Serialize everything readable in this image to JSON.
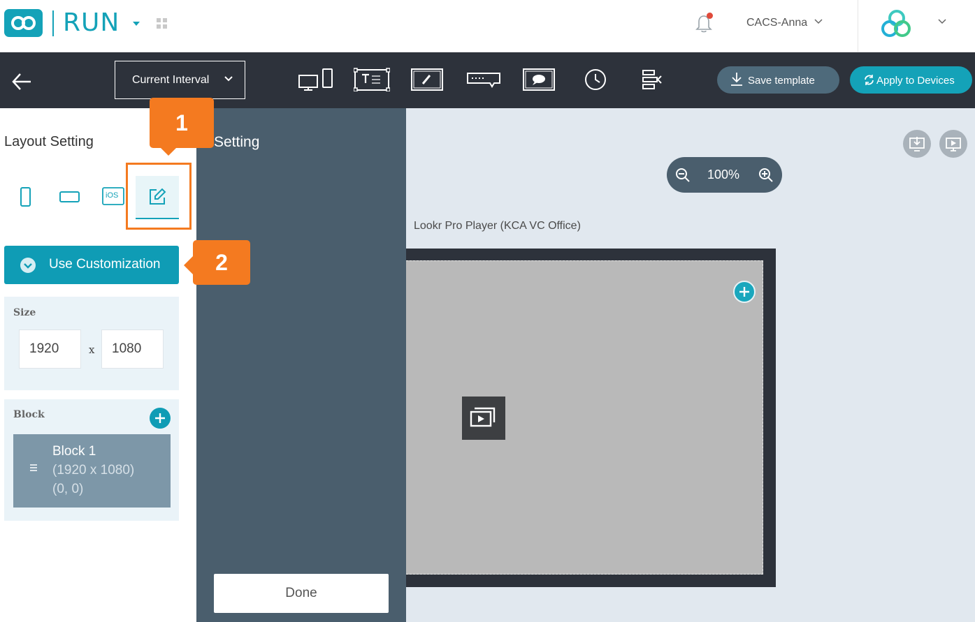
{
  "header": {
    "app_name": "RUN",
    "user_name": "CACS-Anna"
  },
  "toolbar": {
    "interval_select": "Current Interval",
    "tools": [
      "device-toggle-icon",
      "text-widget-icon",
      "draw-icon",
      "ticker-icon",
      "message-icon",
      "clock-icon",
      "align-icon"
    ],
    "save_label": "Save template",
    "apply_label": "Apply to Devices"
  },
  "left_panel": {
    "title": "Layout Setting",
    "orientations": [
      "portrait",
      "landscape",
      "iOS",
      "custom"
    ],
    "ios_label": "iOS",
    "use_customization_label": "Use Customization",
    "size": {
      "label": "Size",
      "width": "1920",
      "height": "1080",
      "separator": "x"
    },
    "block_section": {
      "label": "Block",
      "items": [
        {
          "name": "Block 1",
          "size": "(1920 x 1080)",
          "position": "(0, 0)"
        }
      ]
    }
  },
  "settings_panel": {
    "title": "Setting",
    "done_label": "Done"
  },
  "canvas": {
    "zoom": "100%",
    "device_name": "Lookr Pro Player (KCA VC Office)"
  },
  "callouts": {
    "step1": "1",
    "step2": "2"
  },
  "colors": {
    "accent": "#14a2b8",
    "toolbar_bg": "#2d323b",
    "settings_bg": "#4a5e6d",
    "callout": "#f47a20",
    "canvas_bg": "#e1e8ef"
  }
}
